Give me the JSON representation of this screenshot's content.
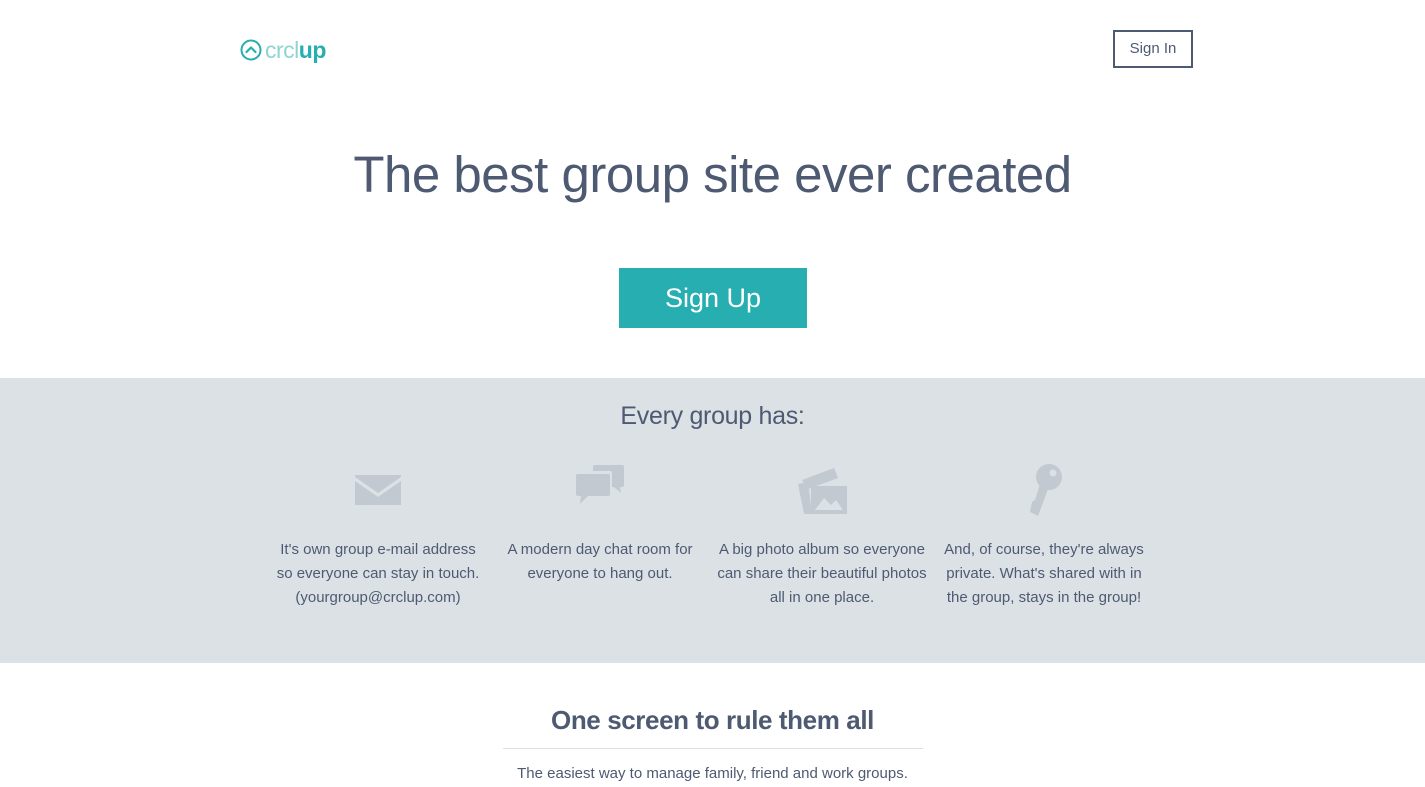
{
  "brand": {
    "logo_part1": "crcl",
    "logo_part2": "up",
    "icon": "circle-chevron-up-icon",
    "color_light": "#8fd4d3",
    "color_accent": "#26aeb0"
  },
  "header": {
    "signin_label": "Sign In"
  },
  "hero": {
    "title": "The best group site ever created",
    "signup_label": "Sign Up"
  },
  "features": {
    "title": "Every group has:",
    "items": [
      {
        "icon": "envelope-icon",
        "text": "It's own group e-mail address so everyone can stay in touch. (yourgroup@crclup.com)"
      },
      {
        "icon": "chat-bubbles-icon",
        "text": "A modern day chat room for everyone to hang out."
      },
      {
        "icon": "photo-album-icon",
        "text": "A big photo album so everyone can share their beautiful photos all in one place."
      },
      {
        "icon": "key-icon",
        "text": "And, of course, they're always private. What's shared with in the group, stays in the group!"
      }
    ]
  },
  "section2": {
    "title": "One screen to rule them all",
    "subtitle": "The easiest way to manage family, friend and work groups."
  },
  "colors": {
    "text": "#4d5a72",
    "band_bg": "#dce1e6",
    "icon_gray": "#c3c9d1"
  }
}
